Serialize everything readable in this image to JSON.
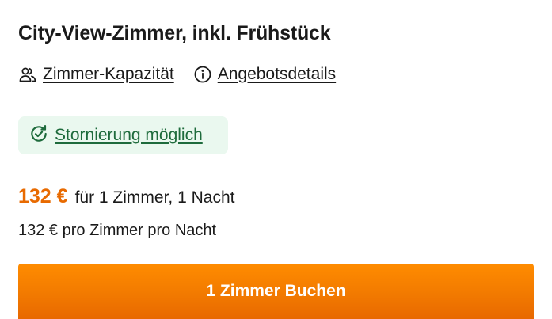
{
  "room": {
    "title": "City-View-Zimmer, inkl. Frühstück"
  },
  "links": {
    "capacity": {
      "label": "Zimmer-Kapazität",
      "icon": "users-icon"
    },
    "offer_details": {
      "label": "Angebotsdetails",
      "icon": "info-icon"
    }
  },
  "cancellation": {
    "label": "Stornierung möglich",
    "icon": "refresh-check-icon",
    "background_color": "#eaf8ef",
    "text_color": "#1e6b3c"
  },
  "price": {
    "amount": "132 €",
    "detail": "für 1 Zimmer, 1 Nacht",
    "per_night": "132 € pro Zimmer pro Nacht",
    "accent_color": "#e86a00"
  },
  "cta": {
    "label": "1 Zimmer Buchen",
    "color": "#f27a00"
  }
}
